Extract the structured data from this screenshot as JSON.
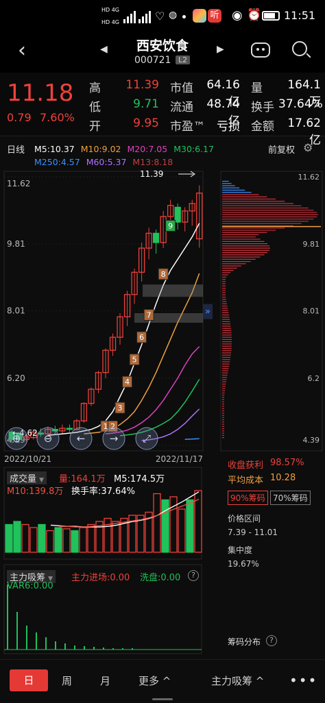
{
  "status_bar": {
    "network1": "HD 4G",
    "network2": "HD 4G",
    "time": "11:51",
    "app_badge": "听"
  },
  "nav": {
    "title": "西安饮食",
    "code": "000721",
    "level_badge": "L2"
  },
  "quote": {
    "price": "11.18",
    "change": "0.79",
    "change_pct": "7.60%",
    "rows": [
      {
        "l1": "高",
        "v1": "11.39",
        "l2": "市值",
        "v2": "64.16亿",
        "l3": "量",
        "v3": "164.1万"
      },
      {
        "l1": "低",
        "v1": "9.71",
        "l2": "流通",
        "v2": "48.74亿",
        "l3": "换手",
        "v3": "37.64%"
      },
      {
        "l1": "开",
        "v1": "9.95",
        "l2": "市盈™",
        "v2": "亏损",
        "l3": "金额",
        "v3": "17.62亿"
      }
    ]
  },
  "kline": {
    "period_label": "日线",
    "ma_legend": [
      {
        "text": "M5:10.37",
        "color": "#ffffff"
      },
      {
        "text": "M10:9.02",
        "color": "#f0a040"
      },
      {
        "text": "M20:7.05",
        "color": "#e040c0"
      },
      {
        "text": "M30:6.17",
        "color": "#21c15c"
      },
      {
        "text": "M250:4.57",
        "color": "#3a8fff"
      },
      {
        "text": "M60:5.37",
        "color": "#b070ff"
      },
      {
        "text": "M13:8.18",
        "color": "#c04040"
      }
    ],
    "adjust_label": "前复权",
    "y_ticks": [
      "11.62",
      "9.81",
      "8.01",
      "6.20",
      "4.39"
    ],
    "high_marker": "11.39",
    "low_marker": "4.62",
    "date_start": "2022/10/21",
    "date_end": "2022/11/17",
    "badges": [
      "1",
      "2",
      "3",
      "4",
      "5",
      "6",
      "7",
      "8",
      "9"
    ],
    "chip_y_ticks": [
      "11.62",
      "9.81",
      "8.01",
      "6.2",
      "4.39"
    ]
  },
  "chip_panel": {
    "profit_label": "收盘获利",
    "profit_value": "98.57%",
    "cost_label": "平均成本",
    "cost_value": "10.28",
    "tab90": "90%筹码",
    "tab70": "70%筹码",
    "range_label": "价格区间",
    "range_value": "7.39 - 11.01",
    "concentration_label": "集中度",
    "concentration_value": "19.67%",
    "dist_label": "筹码分布"
  },
  "volume": {
    "title": "成交量",
    "vol": "量:164.1万",
    "m5": "M5:174.5万",
    "m10": "M10:139.8万",
    "turnover": "换手率:37.64%"
  },
  "flow": {
    "title": "主力吸筹",
    "inflow": "主力进场:0.00",
    "wash": "洗盘:0.00",
    "var6": "VAR6:0.00"
  },
  "bottom_bar": {
    "tabs": [
      "日",
      "周",
      "月",
      "更多"
    ],
    "indicator": "主力吸筹"
  },
  "colors": {
    "up": "#f0413b",
    "down": "#21c15c",
    "accent": "#e53935"
  }
}
